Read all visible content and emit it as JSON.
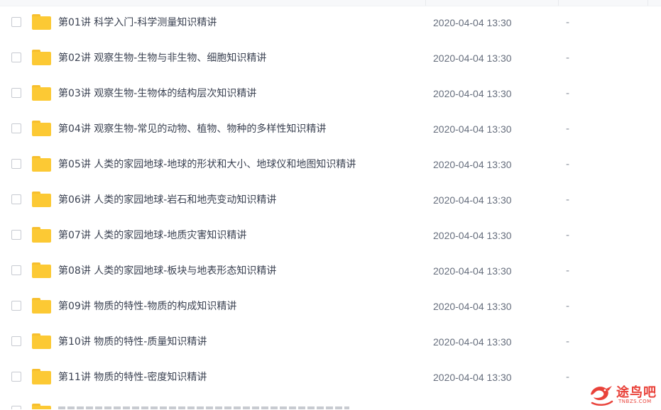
{
  "files": [
    {
      "name": "第01讲 科学入门-科学测量知识精讲",
      "modified": "2020-04-04 13:30",
      "size": "-"
    },
    {
      "name": "第02讲 观察生物-生物与非生物、细胞知识精讲",
      "modified": "2020-04-04 13:30",
      "size": "-"
    },
    {
      "name": "第03讲 观察生物-生物体的结构层次知识精讲",
      "modified": "2020-04-04 13:30",
      "size": "-"
    },
    {
      "name": "第04讲 观察生物-常见的动物、植物、物种的多样性知识精讲",
      "modified": "2020-04-04 13:30",
      "size": "-"
    },
    {
      "name": "第05讲 人类的家园地球-地球的形状和大小、地球仪和地图知识精讲",
      "modified": "2020-04-04 13:30",
      "size": "-"
    },
    {
      "name": "第06讲 人类的家园地球-岩石和地壳变动知识精讲",
      "modified": "2020-04-04 13:30",
      "size": "-"
    },
    {
      "name": "第07讲 人类的家园地球-地质灾害知识精讲",
      "modified": "2020-04-04 13:30",
      "size": "-"
    },
    {
      "name": "第08讲 人类的家园地球-板块与地表形态知识精讲",
      "modified": "2020-04-04 13:30",
      "size": "-"
    },
    {
      "name": "第09讲 物质的特性-物质的构成知识精讲",
      "modified": "2020-04-04 13:30",
      "size": "-"
    },
    {
      "name": "第10讲 物质的特性-质量知识精讲",
      "modified": "2020-04-04 13:30",
      "size": "-"
    },
    {
      "name": "第11讲 物质的特性-密度知识精讲",
      "modified": "2020-04-04 13:30",
      "size": "-"
    }
  ],
  "watermark": {
    "text": "途鸟吧",
    "sub": "TNBZS.COM",
    "icon": "bird-logo-icon",
    "color": "#e9423a"
  },
  "colors": {
    "folder": "#fcc934",
    "text": "#3b4252",
    "muted": "#666e7d"
  }
}
